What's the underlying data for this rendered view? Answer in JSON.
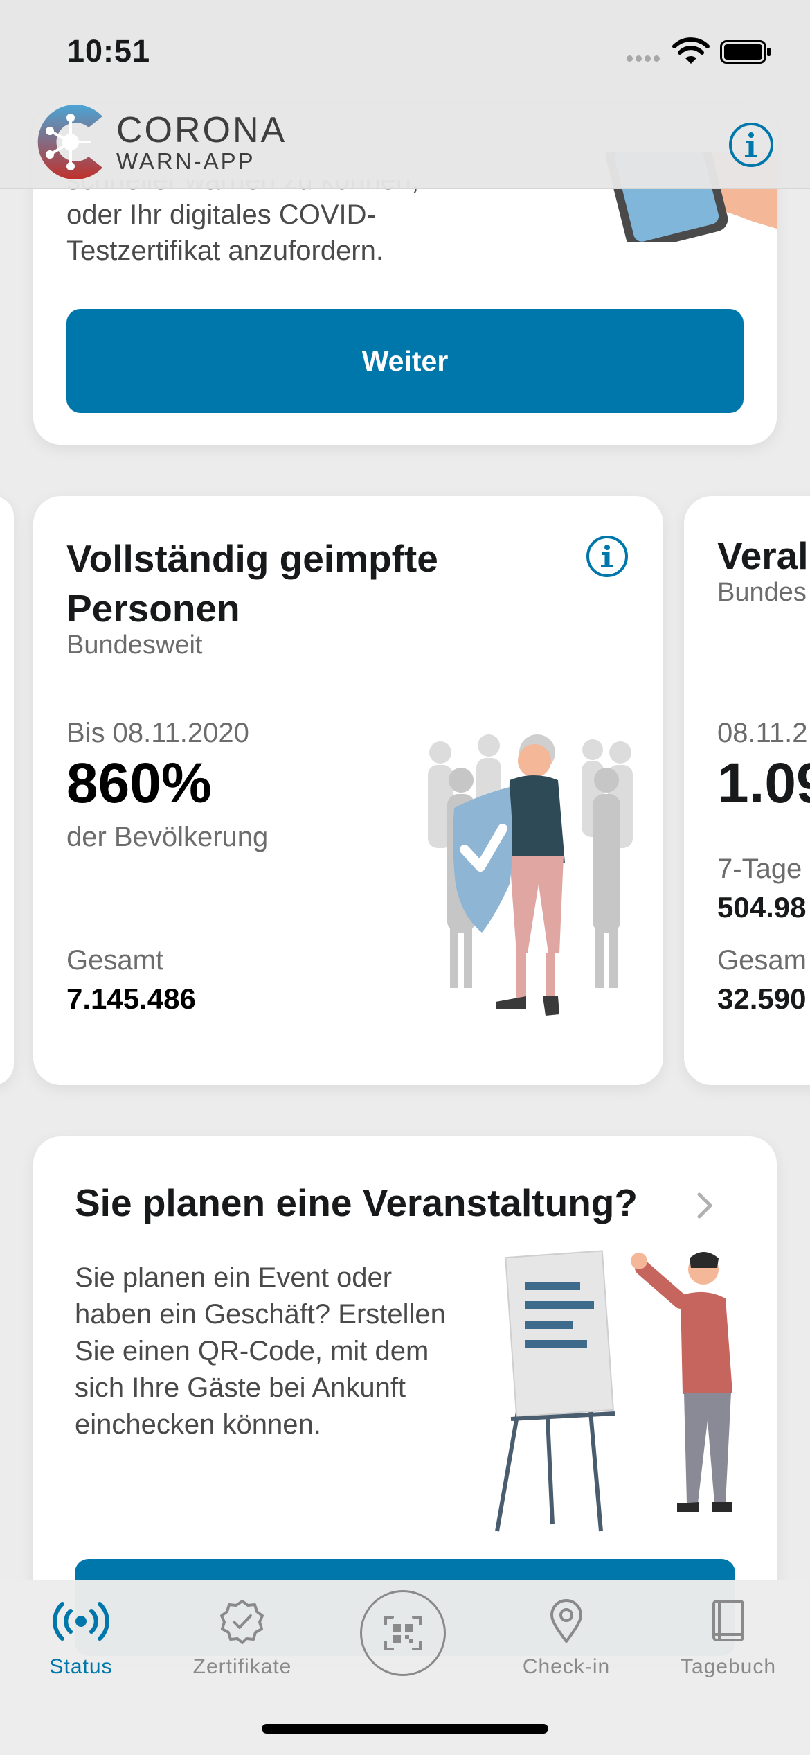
{
  "status_bar": {
    "time": "10:51"
  },
  "header": {
    "brand_line1": "CORONA",
    "brand_line2": "WARN-APP"
  },
  "intro_card": {
    "text_lines": [
      "schneller warnen zu können,",
      "oder Ihr digitales COVID-",
      "Testzertifikat anzufordern."
    ],
    "button_label": "Weiter"
  },
  "stat_card": {
    "title": "Vollständig geimpfte Personen",
    "subtitle": "Bundesweit",
    "date": "Bis 08.11.2020",
    "value": "860%",
    "value_desc": "der Bevölkerung",
    "total_label": "Gesamt",
    "total_value": "7.145.486"
  },
  "next_stat_card": {
    "title": "Veral",
    "subtitle": "Bundes",
    "date": "08.11.2",
    "value": "1.09",
    "label1": "7-Tage",
    "value1": "504.98",
    "label2": "Gesam",
    "value2": "32.590"
  },
  "event_card": {
    "title": "Sie planen eine Veranstaltung?",
    "text": "Sie planen ein Event oder haben ein Geschäft? Erstellen Sie einen QR-Code, mit dem sich Ihre Gäste bei Ankunft einchecken können."
  },
  "tabbar": {
    "status": "Status",
    "certificates": "Zertifikate",
    "checkin": "Check-in",
    "diary": "Tagebuch"
  },
  "colors": {
    "accent": "#0077aa",
    "text": "#17191a",
    "muted": "#6c6c6c"
  },
  "icons": [
    "wifi-icon",
    "battery-icon",
    "app-logo-icon",
    "info-icon",
    "shield-person-illustration",
    "chevron-right-icon",
    "presenter-illustration",
    "status-waves-icon",
    "certificate-badge-icon",
    "qr-scan-icon",
    "location-pin-icon",
    "book-icon"
  ]
}
